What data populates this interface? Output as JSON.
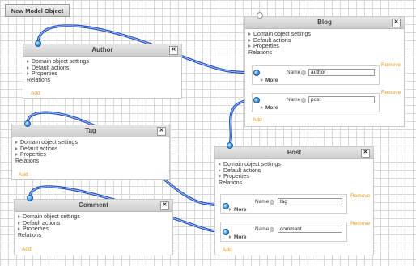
{
  "toolbar": {
    "new_model_label": "New Model Object"
  },
  "boxes": {
    "author": {
      "title": "Author",
      "settings": [
        "Domain object settings",
        "Default actions",
        "Properties"
      ],
      "relations_label": "Relations",
      "add_label": "Add"
    },
    "tag": {
      "title": "Tag",
      "settings": [
        "Domain object settings",
        "Default actions",
        "Properties"
      ],
      "relations_label": "Relations",
      "add_label": "Add"
    },
    "comment": {
      "title": "Comment",
      "settings": [
        "Domain object settings",
        "Default actions",
        "Properties"
      ],
      "relations_label": "Relations",
      "add_label": "Add"
    },
    "blog": {
      "title": "Blog",
      "settings": [
        "Domain object settings",
        "Default actions",
        "Properties"
      ],
      "relations_label": "Relations",
      "add_label": "Add",
      "relations": [
        {
          "name_label": "Name",
          "value": "author",
          "more_label": "More",
          "remove_label": "Remove"
        },
        {
          "name_label": "Name",
          "value": "post",
          "more_label": "More",
          "remove_label": "Remove"
        }
      ]
    },
    "post": {
      "title": "Post",
      "settings": [
        "Domain object settings",
        "Default actions",
        "Properties"
      ],
      "relations_label": "Relations",
      "add_label": "Add",
      "relations": [
        {
          "name_label": "Name",
          "value": "tag",
          "more_label": "More",
          "remove_label": "Remove"
        },
        {
          "name_label": "Name",
          "value": "comment",
          "more_label": "More",
          "remove_label": "Remove"
        }
      ]
    }
  },
  "colors": {
    "wire": "#3366cc",
    "wire_light": "#aabbee",
    "link": "#e39a1a"
  }
}
